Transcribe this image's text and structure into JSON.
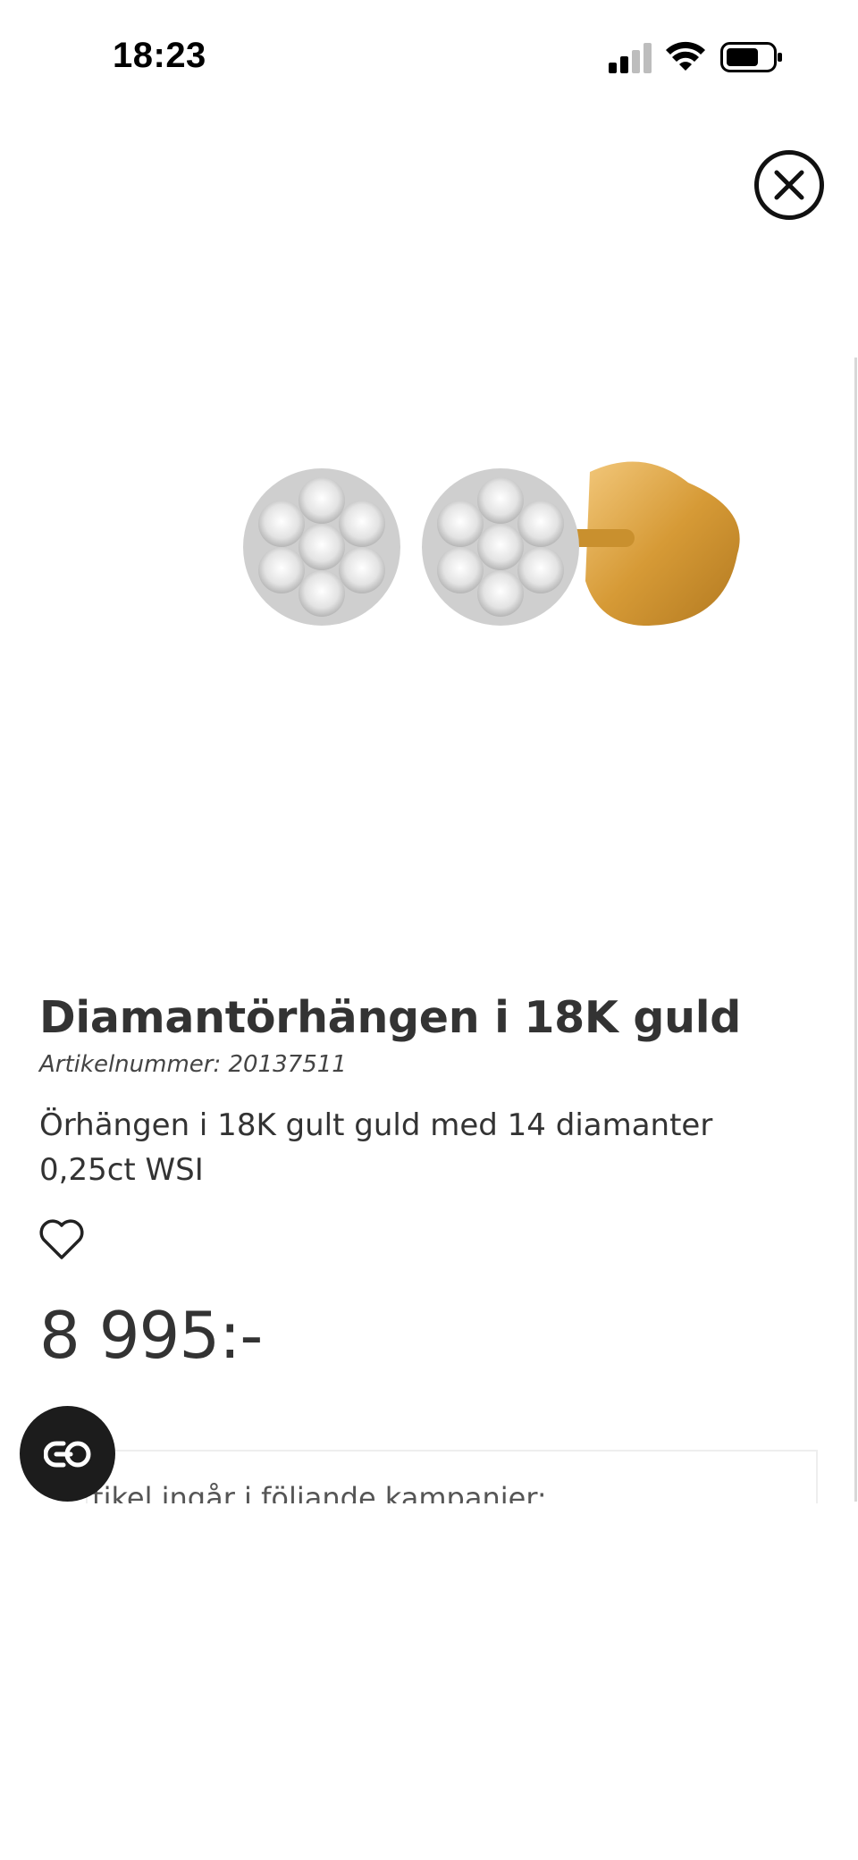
{
  "status_bar": {
    "time": "18:23",
    "icons": [
      "signal-icon",
      "wifi-icon",
      "battery-icon"
    ]
  },
  "close_button": {
    "icon": "close-icon"
  },
  "product": {
    "title": "Diamantörhängen i 18K guld",
    "article_number": "Artikelnummer: 20137511",
    "description": "Örhängen i 18K gult guld med 14 diamanter 0,25ct WSI",
    "price": "8 995:-",
    "favorite_icon": "heart-icon"
  },
  "campaign": {
    "text": "Artikel ingår i följande kampanjer:"
  },
  "chat_button": {
    "icon": "chat-icon"
  },
  "colors": {
    "text": "#333333",
    "gold": "#d9a441",
    "diamond": "#e6e6e6",
    "fab": "#1c1c1c"
  }
}
